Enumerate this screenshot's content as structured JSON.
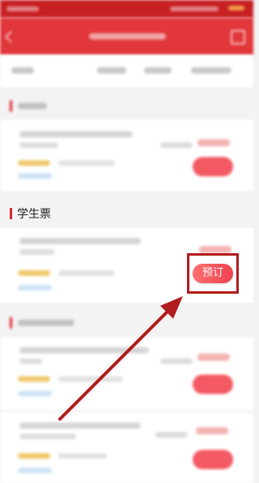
{
  "section": {
    "student_ticket_label": "学生票"
  },
  "card": {
    "book_label": "预订"
  },
  "annotation": {
    "highlight_color": "#b01d1d",
    "arrow_color": "#b01d1d"
  }
}
